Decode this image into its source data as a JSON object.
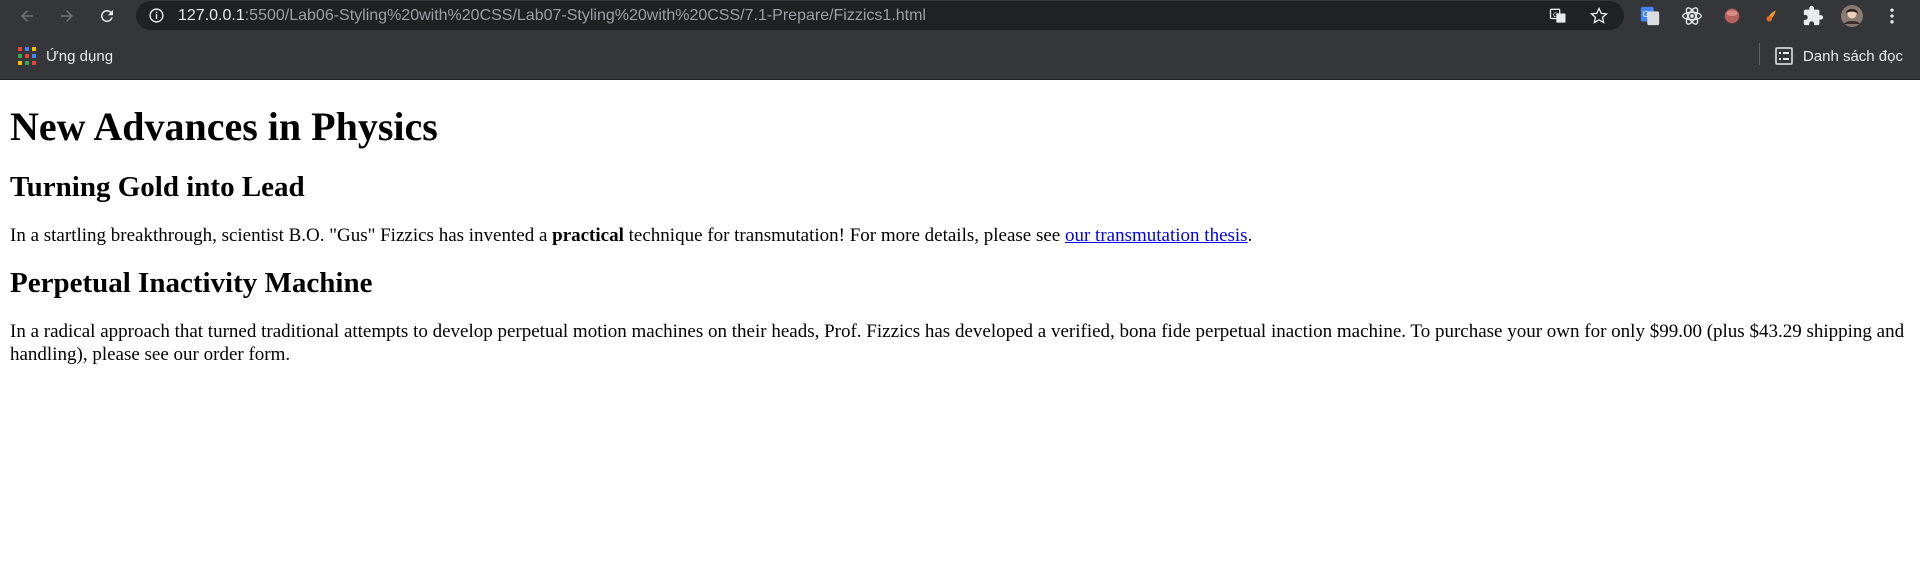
{
  "browser": {
    "url_host": "127.0.0.1",
    "url_path": ":5500/Lab06-Styling%20with%20CSS/Lab07-Styling%20with%20CSS/7.1-Prepare/Fizzics1.html",
    "bookmarks": {
      "apps_label": "Ứng dụng",
      "reading_list_label": "Danh sách đọc"
    }
  },
  "page": {
    "title": "New Advances in Physics",
    "section1": {
      "heading": "Turning Gold into Lead",
      "text_before": "In a startling breakthrough, scientist B.O. \"Gus\" Fizzics has invented a ",
      "bold": "practical",
      "text_middle": " technique for transmutation! For more details, please see ",
      "link": "our transmutation thesis",
      "text_after": "."
    },
    "section2": {
      "heading": "Perpetual Inactivity Machine",
      "text": "In a radical approach that turned traditional attempts to develop perpetual motion machines on their heads, Prof. Fizzics has developed a verified, bona fide perpetual inaction machine. To purchase your own for only $99.00 (plus $43.29 shipping and handling), please see our order form."
    }
  }
}
